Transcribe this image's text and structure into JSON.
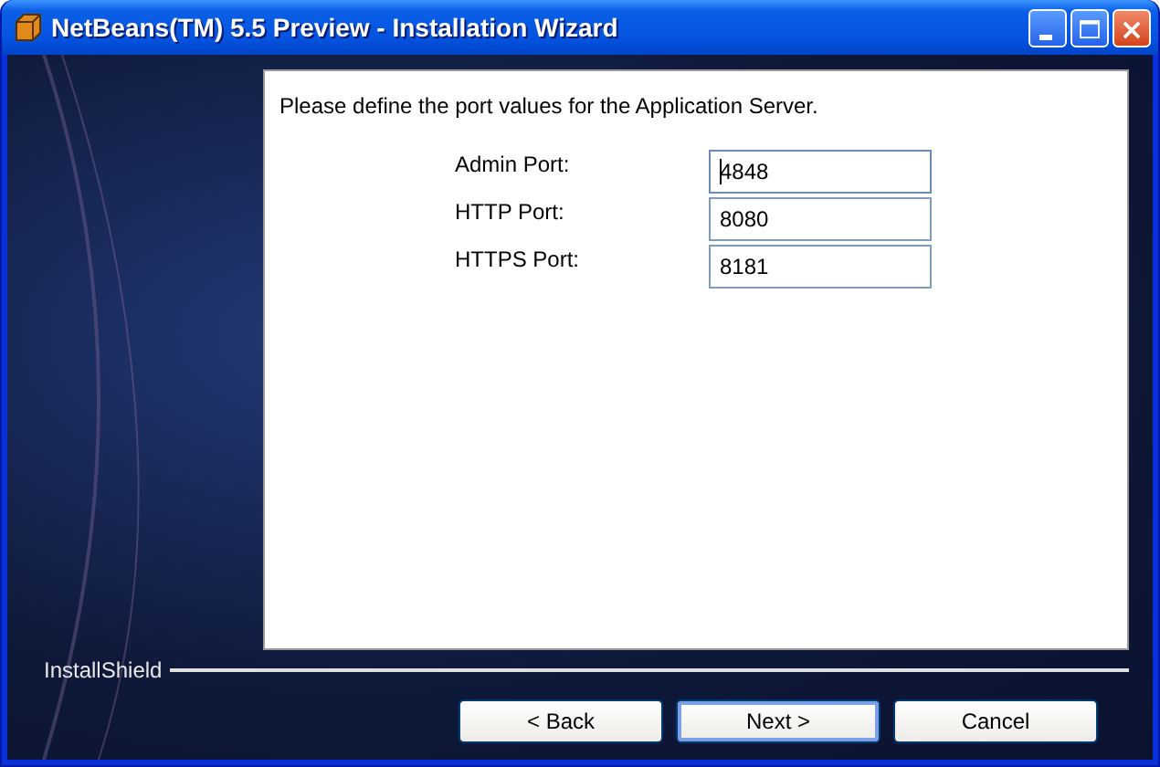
{
  "window": {
    "title": "NetBeans(TM) 5.5 Preview - Installation Wizard"
  },
  "instruction": "Please define the port values for the Application Server.",
  "fields": [
    {
      "label": "Admin Port:",
      "value": "4848",
      "focused": true
    },
    {
      "label": "HTTP Port:",
      "value": "8080",
      "focused": false
    },
    {
      "label": "HTTPS Port:",
      "value": "8181",
      "focused": false
    }
  ],
  "brand": "InstallShield",
  "buttons": [
    {
      "label": "< Back",
      "default": false
    },
    {
      "label": "Next >",
      "default": true
    },
    {
      "label": "Cancel",
      "default": false
    }
  ]
}
